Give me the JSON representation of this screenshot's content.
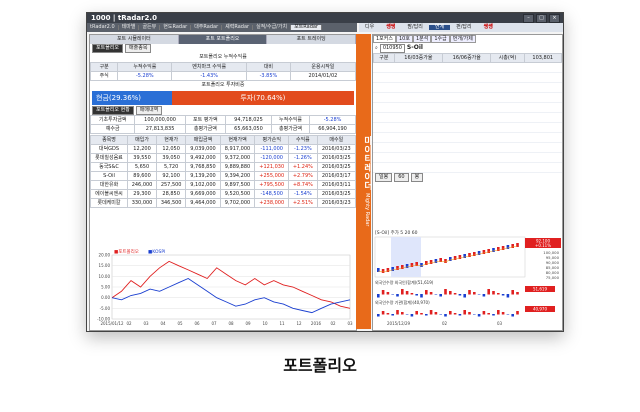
{
  "window": {
    "title": "1000 | tRadar2.0"
  },
  "menu": [
    "tRadar2.0",
    "테마별",
    "골든뷰",
    "현도Radar",
    "대주Radar",
    "셰력Radar",
    "실적/수급/가치",
    "포트Radar"
  ],
  "top_right": [
    "디우",
    "쌩쌩",
    "팜/답리",
    "연계",
    "펀/답리",
    "쌩쌩"
  ],
  "left": {
    "subtabs": [
      "포트 시뮬레이터",
      "포트 포트폴리오",
      "포트 트레이딩"
    ],
    "modes": [
      "포트폴리오",
      "매출종목"
    ],
    "summary_title": "포트폴리오 누적수익률",
    "summary_header": [
      "구분",
      "누적수익률",
      "벤치마크 수익률",
      "대비",
      "운용시작일"
    ],
    "summary_row": [
      "주식",
      "-5.28%",
      "-1.43%",
      "-3.85%",
      "2014/01/02"
    ],
    "ratio_title": "포트폴리오 투자비중",
    "cash_label": "현금(29.36%)",
    "invest_label": "투자(70.64%)",
    "status_tabs": [
      "포트폴리오 현황",
      "매매내역"
    ],
    "status_rows": [
      [
        "기초투자금액",
        "100,000,000",
        "포트 평가액",
        "94,718,025",
        "누적수익률",
        "-5.28%"
      ],
      [
        "예수금",
        "27,813,835",
        "총평가금액",
        "65,663,050",
        "총평가금액",
        "66,904,190"
      ]
    ],
    "hold_header": [
      "종목명",
      "매입가",
      "현재가",
      "매입금액",
      "현재가액",
      "평가손익",
      "수익률",
      "매수일"
    ],
    "holdings": [
      [
        "대덕GDS",
        "12,200",
        "12,050",
        "9,039,000",
        "8,917,000",
        "-111,000",
        "-1.23%",
        "2016/03/23"
      ],
      [
        "롯데칠성음료",
        "39,550",
        "39,050",
        "9,492,000",
        "9,372,000",
        "-120,000",
        "-1.26%",
        "2016/03/25"
      ],
      [
        "동국S&C",
        "5,650",
        "5,720",
        "9,768,850",
        "9,889,880",
        "+121,030",
        "+1.24%",
        "2016/03/25"
      ],
      [
        "S-Oil",
        "89,600",
        "92,100",
        "9,139,200",
        "9,394,200",
        "+255,000",
        "+2.79%",
        "2016/03/17"
      ],
      [
        "대한유화",
        "246,000",
        "257,500",
        "9,102,000",
        "9,897,500",
        "+795,500",
        "+8.74%",
        "2016/03/11"
      ],
      [
        "에이블씨엔씨",
        "29,300",
        "28,850",
        "9,669,000",
        "9,520,500",
        "-148,500",
        "-1.54%",
        "2016/03/25"
      ],
      [
        "롯데케미칼",
        "330,000",
        "346,500",
        "9,464,000",
        "9,702,000",
        "+238,000",
        "+2.51%",
        "2016/03/23"
      ]
    ],
    "chart_legend": [
      "포트폴리오",
      "KOSPI"
    ],
    "chart_ticks_x": [
      "2015/01/12",
      "02",
      "03",
      "04",
      "05",
      "06",
      "07",
      "08",
      "09",
      "10",
      "11",
      "12",
      "2016",
      "02",
      "03"
    ],
    "chart_ticks_y": [
      "20.00",
      "15.00",
      "10.00",
      "5.00",
      "0.00",
      "-5.00",
      "-10.00"
    ]
  },
  "strip": {
    "title": "마이티레이더",
    "sub": "Mighty Radar"
  },
  "right": {
    "tabs": [
      "1포커스",
      "10호",
      "1분석",
      "1수급",
      "번개/가제"
    ],
    "code": "010950",
    "name": "S-Oil",
    "stats_header": [
      "구분",
      "16/03증가율",
      "16/06증가율",
      "시총(억)",
      "103,801"
    ],
    "chart_periods": [
      "일봉",
      "60",
      "봉"
    ],
    "chart_title": "[S-Oil] 주가 5 20 60",
    "price_labels": [
      "92,100",
      "+0.11%"
    ],
    "y_ticks": [
      "100,000",
      "95,000",
      "90,000",
      "85,000",
      "80,000",
      "75,000"
    ],
    "x_ticks": [
      "2015/12/29",
      "02",
      "03"
    ],
    "sub1_title": "외국인수량 외국인(합계)(51,619)",
    "sub1_value": "51,619",
    "sub2_title": "외국인수량 기관(합계)(40,970)",
    "sub2_value": "40,970"
  },
  "caption": "포트폴리오",
  "chart_data": [
    {
      "type": "line",
      "title": "",
      "series": [
        {
          "name": "포트폴리오",
          "values": [
            0,
            3,
            8,
            5,
            10,
            14,
            17,
            15,
            13,
            11,
            9,
            14,
            11,
            8,
            6,
            9,
            6,
            8,
            6,
            5,
            3,
            1,
            -1,
            -2,
            -4,
            -5
          ]
        },
        {
          "name": "KOSPI",
          "values": [
            0,
            -1,
            1,
            2,
            4,
            3,
            5,
            7,
            9,
            6,
            3,
            0,
            -2,
            -4,
            -3,
            -1,
            0,
            -2,
            -3,
            -5,
            -6,
            -7,
            -5,
            -3,
            -2,
            -1
          ]
        }
      ],
      "ylim": [
        -10,
        20
      ]
    }
  ],
  "colors": {
    "accent": "#e86a1a",
    "cash": "#2a6fd6",
    "invest": "#e24b1d",
    "up": "#d21",
    "down": "#1a3fd0"
  }
}
